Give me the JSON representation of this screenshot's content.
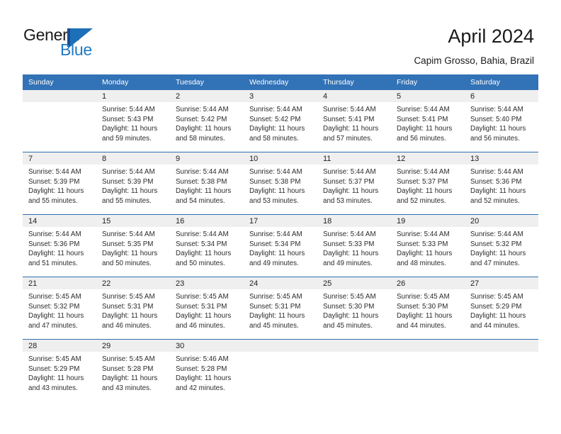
{
  "brand": {
    "name_part1": "General",
    "name_part2": "Blue",
    "accent_color": "#1f7ac4",
    "mark_color": "#1d6fb8"
  },
  "header": {
    "title": "April 2024",
    "subtitle": "Capim Grosso, Bahia, Brazil"
  },
  "theme": {
    "header_row_bg": "#3272b6",
    "daynum_bg": "#efefef",
    "row_divider": "#2f6fb0"
  },
  "weekday_headers": [
    "Sunday",
    "Monday",
    "Tuesday",
    "Wednesday",
    "Thursday",
    "Friday",
    "Saturday"
  ],
  "weeks": [
    [
      {
        "empty": true
      },
      {
        "day": "1",
        "sunrise": "Sunrise: 5:44 AM",
        "sunset": "Sunset: 5:43 PM",
        "daylight1": "Daylight: 11 hours",
        "daylight2": "and 59 minutes."
      },
      {
        "day": "2",
        "sunrise": "Sunrise: 5:44 AM",
        "sunset": "Sunset: 5:42 PM",
        "daylight1": "Daylight: 11 hours",
        "daylight2": "and 58 minutes."
      },
      {
        "day": "3",
        "sunrise": "Sunrise: 5:44 AM",
        "sunset": "Sunset: 5:42 PM",
        "daylight1": "Daylight: 11 hours",
        "daylight2": "and 58 minutes."
      },
      {
        "day": "4",
        "sunrise": "Sunrise: 5:44 AM",
        "sunset": "Sunset: 5:41 PM",
        "daylight1": "Daylight: 11 hours",
        "daylight2": "and 57 minutes."
      },
      {
        "day": "5",
        "sunrise": "Sunrise: 5:44 AM",
        "sunset": "Sunset: 5:41 PM",
        "daylight1": "Daylight: 11 hours",
        "daylight2": "and 56 minutes."
      },
      {
        "day": "6",
        "sunrise": "Sunrise: 5:44 AM",
        "sunset": "Sunset: 5:40 PM",
        "daylight1": "Daylight: 11 hours",
        "daylight2": "and 56 minutes."
      }
    ],
    [
      {
        "day": "7",
        "sunrise": "Sunrise: 5:44 AM",
        "sunset": "Sunset: 5:39 PM",
        "daylight1": "Daylight: 11 hours",
        "daylight2": "and 55 minutes."
      },
      {
        "day": "8",
        "sunrise": "Sunrise: 5:44 AM",
        "sunset": "Sunset: 5:39 PM",
        "daylight1": "Daylight: 11 hours",
        "daylight2": "and 55 minutes."
      },
      {
        "day": "9",
        "sunrise": "Sunrise: 5:44 AM",
        "sunset": "Sunset: 5:38 PM",
        "daylight1": "Daylight: 11 hours",
        "daylight2": "and 54 minutes."
      },
      {
        "day": "10",
        "sunrise": "Sunrise: 5:44 AM",
        "sunset": "Sunset: 5:38 PM",
        "daylight1": "Daylight: 11 hours",
        "daylight2": "and 53 minutes."
      },
      {
        "day": "11",
        "sunrise": "Sunrise: 5:44 AM",
        "sunset": "Sunset: 5:37 PM",
        "daylight1": "Daylight: 11 hours",
        "daylight2": "and 53 minutes."
      },
      {
        "day": "12",
        "sunrise": "Sunrise: 5:44 AM",
        "sunset": "Sunset: 5:37 PM",
        "daylight1": "Daylight: 11 hours",
        "daylight2": "and 52 minutes."
      },
      {
        "day": "13",
        "sunrise": "Sunrise: 5:44 AM",
        "sunset": "Sunset: 5:36 PM",
        "daylight1": "Daylight: 11 hours",
        "daylight2": "and 52 minutes."
      }
    ],
    [
      {
        "day": "14",
        "sunrise": "Sunrise: 5:44 AM",
        "sunset": "Sunset: 5:36 PM",
        "daylight1": "Daylight: 11 hours",
        "daylight2": "and 51 minutes."
      },
      {
        "day": "15",
        "sunrise": "Sunrise: 5:44 AM",
        "sunset": "Sunset: 5:35 PM",
        "daylight1": "Daylight: 11 hours",
        "daylight2": "and 50 minutes."
      },
      {
        "day": "16",
        "sunrise": "Sunrise: 5:44 AM",
        "sunset": "Sunset: 5:34 PM",
        "daylight1": "Daylight: 11 hours",
        "daylight2": "and 50 minutes."
      },
      {
        "day": "17",
        "sunrise": "Sunrise: 5:44 AM",
        "sunset": "Sunset: 5:34 PM",
        "daylight1": "Daylight: 11 hours",
        "daylight2": "and 49 minutes."
      },
      {
        "day": "18",
        "sunrise": "Sunrise: 5:44 AM",
        "sunset": "Sunset: 5:33 PM",
        "daylight1": "Daylight: 11 hours",
        "daylight2": "and 49 minutes."
      },
      {
        "day": "19",
        "sunrise": "Sunrise: 5:44 AM",
        "sunset": "Sunset: 5:33 PM",
        "daylight1": "Daylight: 11 hours",
        "daylight2": "and 48 minutes."
      },
      {
        "day": "20",
        "sunrise": "Sunrise: 5:44 AM",
        "sunset": "Sunset: 5:32 PM",
        "daylight1": "Daylight: 11 hours",
        "daylight2": "and 47 minutes."
      }
    ],
    [
      {
        "day": "21",
        "sunrise": "Sunrise: 5:45 AM",
        "sunset": "Sunset: 5:32 PM",
        "daylight1": "Daylight: 11 hours",
        "daylight2": "and 47 minutes."
      },
      {
        "day": "22",
        "sunrise": "Sunrise: 5:45 AM",
        "sunset": "Sunset: 5:31 PM",
        "daylight1": "Daylight: 11 hours",
        "daylight2": "and 46 minutes."
      },
      {
        "day": "23",
        "sunrise": "Sunrise: 5:45 AM",
        "sunset": "Sunset: 5:31 PM",
        "daylight1": "Daylight: 11 hours",
        "daylight2": "and 46 minutes."
      },
      {
        "day": "24",
        "sunrise": "Sunrise: 5:45 AM",
        "sunset": "Sunset: 5:31 PM",
        "daylight1": "Daylight: 11 hours",
        "daylight2": "and 45 minutes."
      },
      {
        "day": "25",
        "sunrise": "Sunrise: 5:45 AM",
        "sunset": "Sunset: 5:30 PM",
        "daylight1": "Daylight: 11 hours",
        "daylight2": "and 45 minutes."
      },
      {
        "day": "26",
        "sunrise": "Sunrise: 5:45 AM",
        "sunset": "Sunset: 5:30 PM",
        "daylight1": "Daylight: 11 hours",
        "daylight2": "and 44 minutes."
      },
      {
        "day": "27",
        "sunrise": "Sunrise: 5:45 AM",
        "sunset": "Sunset: 5:29 PM",
        "daylight1": "Daylight: 11 hours",
        "daylight2": "and 44 minutes."
      }
    ],
    [
      {
        "day": "28",
        "sunrise": "Sunrise: 5:45 AM",
        "sunset": "Sunset: 5:29 PM",
        "daylight1": "Daylight: 11 hours",
        "daylight2": "and 43 minutes."
      },
      {
        "day": "29",
        "sunrise": "Sunrise: 5:45 AM",
        "sunset": "Sunset: 5:28 PM",
        "daylight1": "Daylight: 11 hours",
        "daylight2": "and 43 minutes."
      },
      {
        "day": "30",
        "sunrise": "Sunrise: 5:46 AM",
        "sunset": "Sunset: 5:28 PM",
        "daylight1": "Daylight: 11 hours",
        "daylight2": "and 42 minutes."
      },
      {
        "empty": true
      },
      {
        "empty": true
      },
      {
        "empty": true
      },
      {
        "empty": true
      }
    ]
  ]
}
